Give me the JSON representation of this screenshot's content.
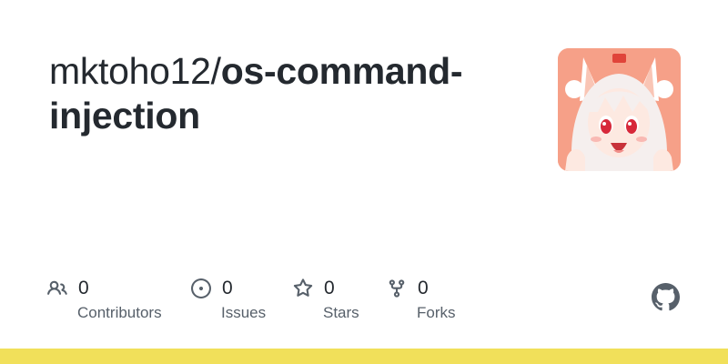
{
  "repo": {
    "owner_prefix": "mktoho12/",
    "name": "os-command-injection"
  },
  "avatar": {
    "icon": "anime-character-avatar",
    "bg_color": "#f6a088"
  },
  "stats": [
    {
      "icon": "people-icon",
      "count": "0",
      "label": "Contributors"
    },
    {
      "icon": "issue-circle-icon",
      "count": "0",
      "label": "Issues"
    },
    {
      "icon": "star-icon",
      "count": "0",
      "label": "Stars"
    },
    {
      "icon": "fork-icon",
      "count": "0",
      "label": "Forks"
    }
  ],
  "logo": {
    "icon": "github-icon"
  },
  "language_bar": {
    "color": "#f1e05a"
  }
}
